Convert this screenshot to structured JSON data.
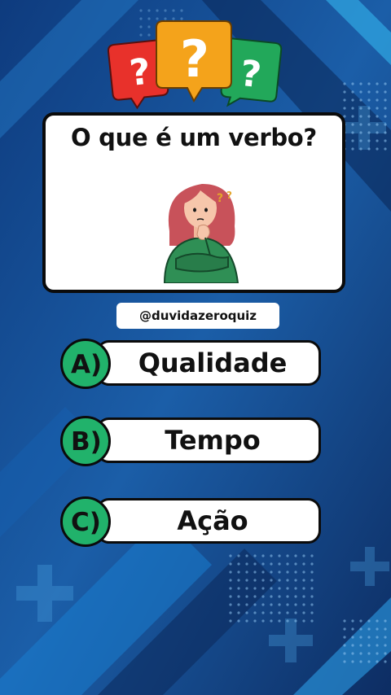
{
  "header": {
    "bubbles": [
      {
        "symbol": "?",
        "color": "#e8312b"
      },
      {
        "symbol": "?",
        "color": "#f4a31b"
      },
      {
        "symbol": "?",
        "color": "#22a85a"
      }
    ]
  },
  "question": {
    "text": "O que é um verbo?",
    "illustration": "thinking-woman-icon"
  },
  "handle": "@duvidazeroquiz",
  "options": [
    {
      "letter": "A)",
      "text": "Qualidade"
    },
    {
      "letter": "B)",
      "text": "Tempo"
    },
    {
      "letter": "C)",
      "text": "Ação"
    }
  ],
  "colors": {
    "background_dark": "#0d2d63",
    "background_light": "#1f75c9",
    "accent_green": "#21b26b",
    "card": "#ffffff"
  }
}
